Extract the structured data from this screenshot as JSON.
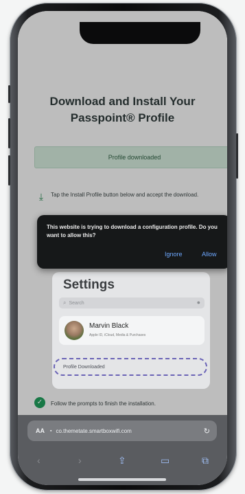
{
  "page": {
    "title": "Download and Install Your Passpoint® Profile",
    "banner": "Profile downloaded",
    "step1": "Tap the Install Profile button below and accept the download.",
    "step3": "Follow the prompts to finish the installation."
  },
  "alert": {
    "message": "This website is trying to download a configuration profile. Do you want to allow this?",
    "ignore_label": "Ignore",
    "allow_label": "Allow"
  },
  "settings_card": {
    "title": "Settings",
    "search_placeholder": "Search",
    "profile_name": "Marvin Black",
    "profile_sub": "Apple ID, iCloud, Media & Purchases",
    "downloaded_label": "Profile Downloaded"
  },
  "browser": {
    "aa_label": "AA",
    "url": "co.themetate.smartboxwifi.com"
  },
  "icons": {
    "download": "download-icon",
    "check": "check-icon",
    "search": "search-icon",
    "mic": "mic-icon",
    "reload": "reload-icon",
    "share": "share-icon",
    "bookmarks": "bookmarks-icon",
    "tabs": "tabs-icon"
  },
  "colors": {
    "banner_bg": "#cfe5d7",
    "accent_green": "#1f9a5a",
    "alert_bg": "#161819",
    "alert_button": "#6ea8ff",
    "dashed_outline": "#6a63b6"
  }
}
